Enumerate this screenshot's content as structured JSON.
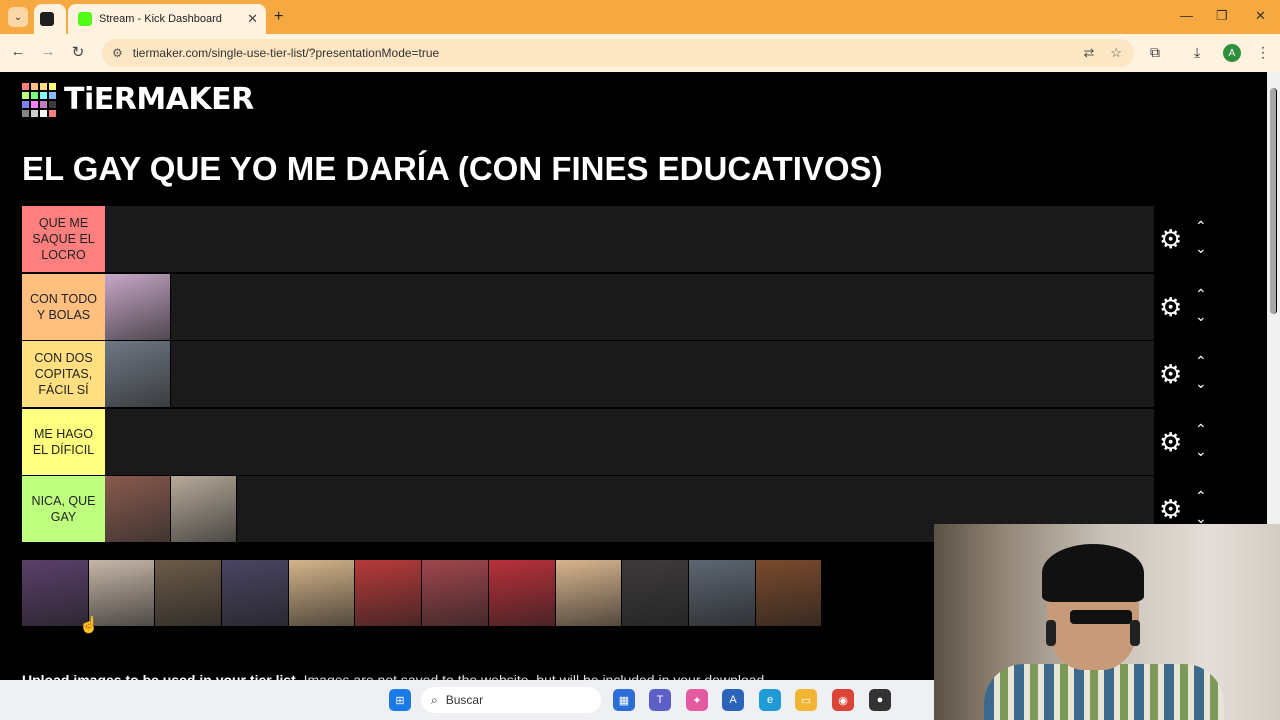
{
  "browser": {
    "tabs": [
      {
        "label": "",
        "fav_color": "#1f1f1f"
      },
      {
        "label": "Stream - Kick Dashboard",
        "fav_color": "#53fc18"
      }
    ],
    "new_tab": "+",
    "url": "tiermaker.com/single-use-tier-list/?presentationMode=true",
    "profile_initial": "A"
  },
  "page": {
    "logo_text": "TiERMAKER",
    "logo_colors": [
      "#ff7f7f",
      "#ffbf7f",
      "#ffdf7f",
      "#ffff7f",
      "#bfff7f",
      "#7fff7f",
      "#7fffff",
      "#7fbfff",
      "#7f7fff",
      "#ff7fff",
      "#bf7fbf",
      "#3b3b3b",
      "#858585",
      "#cfcfcf",
      "#f7f7f7",
      "#ff7f7f"
    ],
    "title": "EL GAY QUE YO ME DARÍA (CON FINES EDUCATIVOS)",
    "tiers": [
      {
        "label": "QUE ME SAQUE EL LOCRO",
        "color": "#ff7f7f",
        "items": []
      },
      {
        "label": "CON TODO Y BOLAS",
        "color": "#ffbf7f",
        "items": [
          {
            "name": "red-hair-woman",
            "color": "#c8a7c9"
          }
        ]
      },
      {
        "label": "CON DOS COPITAS, FÁCIL SÍ",
        "color": "#ffdf7f",
        "items": [
          {
            "name": "man-gym",
            "color": "#6f7885"
          }
        ]
      },
      {
        "label": "ME HAGO EL DÍFICIL",
        "color": "#ffff7f",
        "items": []
      },
      {
        "label": "NICA, QUE GAY",
        "color": "#bfff7f",
        "items": [
          {
            "name": "woman-dark-hair",
            "color": "#8a5a4d"
          },
          {
            "name": "curly-hair-person",
            "color": "#b7aa9a"
          }
        ]
      }
    ],
    "pool": [
      {
        "name": "pool-item-1",
        "color": "#5a3f6a"
      },
      {
        "name": "pool-item-2",
        "color": "#c6b6a8"
      },
      {
        "name": "pool-item-3",
        "color": "#6b5a48"
      },
      {
        "name": "pool-item-4",
        "color": "#4a4462"
      },
      {
        "name": "pool-item-5",
        "color": "#d4b48a"
      },
      {
        "name": "pool-item-6",
        "color": "#b83a3a"
      },
      {
        "name": "pool-item-7",
        "color": "#a0464c"
      },
      {
        "name": "pool-item-8",
        "color": "#b9303a"
      },
      {
        "name": "pool-item-9",
        "color": "#d8b58e"
      },
      {
        "name": "pool-item-10",
        "color": "#3d3a3c"
      },
      {
        "name": "pool-item-11",
        "color": "#5c6672"
      },
      {
        "name": "pool-item-12",
        "color": "#7a4a2c"
      }
    ],
    "upload_bold": "Upload images to be used in your tier list.",
    "upload_rest": " Images are not saved to the website, but will be included in your download."
  },
  "taskbar": {
    "search_placeholder": "Buscar"
  }
}
